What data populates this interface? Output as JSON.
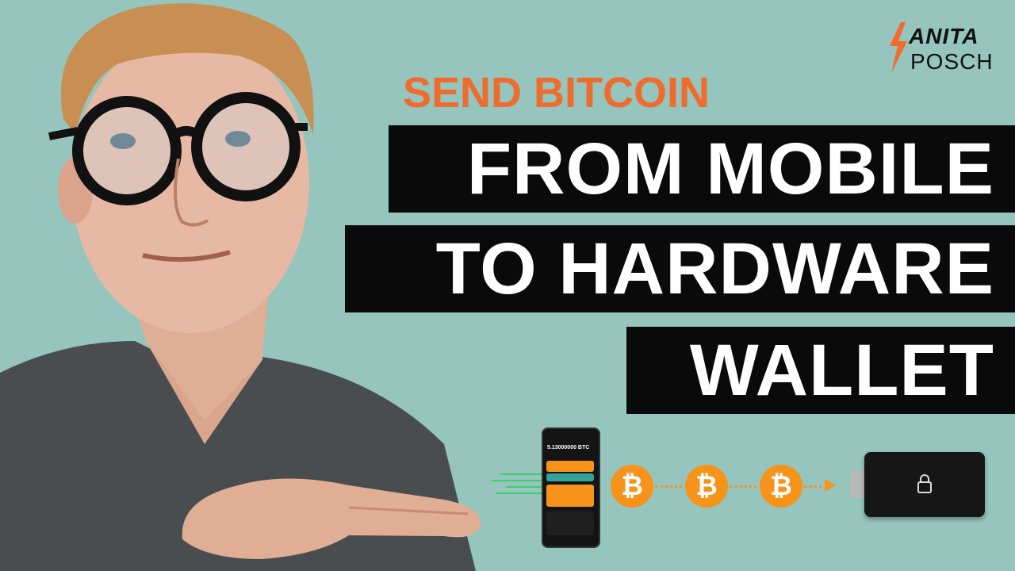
{
  "brand": {
    "line1": "ANITA",
    "line2": "POSCH",
    "accent": "#f26b2a"
  },
  "kicker": "SEND BITCOIN",
  "headline": {
    "line1": "FROM MOBILE",
    "line2": "TO HARDWARE",
    "line3": "WALLET"
  },
  "phone": {
    "balance": "5.13000000 BTC"
  },
  "coin_symbol": "₿",
  "colors": {
    "background": "#95c5bd",
    "kicker": "#ef6c2f",
    "banner": "#0a0a0a",
    "bitcoin": "#f7931a"
  }
}
